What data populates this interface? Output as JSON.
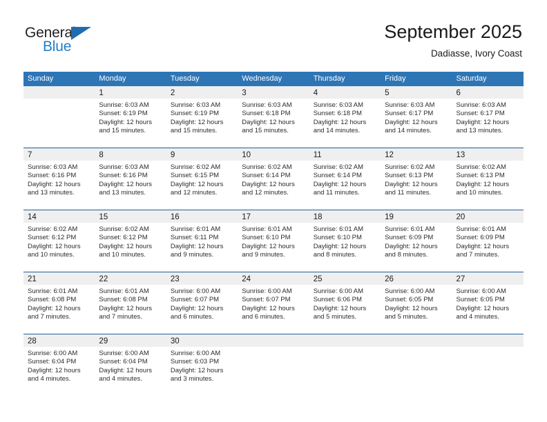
{
  "brand": {
    "name_part1": "General",
    "name_part2": "Blue",
    "triangle_color": "#1f6cb0",
    "blue_color": "#1f7dc9"
  },
  "header": {
    "title": "September 2025",
    "subtitle": "Dadiasse, Ivory Coast"
  },
  "theme": {
    "header_blue": "#2e75b6",
    "row_divider_blue": "#1f5f9e",
    "daynum_band": "#efefef"
  },
  "calendar": {
    "weekday_headers": [
      "Sunday",
      "Monday",
      "Tuesday",
      "Wednesday",
      "Thursday",
      "Friday",
      "Saturday"
    ],
    "weeks": [
      [
        {
          "day": "",
          "sunrise": "",
          "sunset": "",
          "daylight1": "",
          "daylight2": "",
          "empty": true
        },
        {
          "day": "1",
          "sunrise": "Sunrise: 6:03 AM",
          "sunset": "Sunset: 6:19 PM",
          "daylight1": "Daylight: 12 hours",
          "daylight2": "and 15 minutes."
        },
        {
          "day": "2",
          "sunrise": "Sunrise: 6:03 AM",
          "sunset": "Sunset: 6:19 PM",
          "daylight1": "Daylight: 12 hours",
          "daylight2": "and 15 minutes."
        },
        {
          "day": "3",
          "sunrise": "Sunrise: 6:03 AM",
          "sunset": "Sunset: 6:18 PM",
          "daylight1": "Daylight: 12 hours",
          "daylight2": "and 15 minutes."
        },
        {
          "day": "4",
          "sunrise": "Sunrise: 6:03 AM",
          "sunset": "Sunset: 6:18 PM",
          "daylight1": "Daylight: 12 hours",
          "daylight2": "and 14 minutes."
        },
        {
          "day": "5",
          "sunrise": "Sunrise: 6:03 AM",
          "sunset": "Sunset: 6:17 PM",
          "daylight1": "Daylight: 12 hours",
          "daylight2": "and 14 minutes."
        },
        {
          "day": "6",
          "sunrise": "Sunrise: 6:03 AM",
          "sunset": "Sunset: 6:17 PM",
          "daylight1": "Daylight: 12 hours",
          "daylight2": "and 13 minutes."
        }
      ],
      [
        {
          "day": "7",
          "sunrise": "Sunrise: 6:03 AM",
          "sunset": "Sunset: 6:16 PM",
          "daylight1": "Daylight: 12 hours",
          "daylight2": "and 13 minutes."
        },
        {
          "day": "8",
          "sunrise": "Sunrise: 6:03 AM",
          "sunset": "Sunset: 6:16 PM",
          "daylight1": "Daylight: 12 hours",
          "daylight2": "and 13 minutes."
        },
        {
          "day": "9",
          "sunrise": "Sunrise: 6:02 AM",
          "sunset": "Sunset: 6:15 PM",
          "daylight1": "Daylight: 12 hours",
          "daylight2": "and 12 minutes."
        },
        {
          "day": "10",
          "sunrise": "Sunrise: 6:02 AM",
          "sunset": "Sunset: 6:14 PM",
          "daylight1": "Daylight: 12 hours",
          "daylight2": "and 12 minutes."
        },
        {
          "day": "11",
          "sunrise": "Sunrise: 6:02 AM",
          "sunset": "Sunset: 6:14 PM",
          "daylight1": "Daylight: 12 hours",
          "daylight2": "and 11 minutes."
        },
        {
          "day": "12",
          "sunrise": "Sunrise: 6:02 AM",
          "sunset": "Sunset: 6:13 PM",
          "daylight1": "Daylight: 12 hours",
          "daylight2": "and 11 minutes."
        },
        {
          "day": "13",
          "sunrise": "Sunrise: 6:02 AM",
          "sunset": "Sunset: 6:13 PM",
          "daylight1": "Daylight: 12 hours",
          "daylight2": "and 10 minutes."
        }
      ],
      [
        {
          "day": "14",
          "sunrise": "Sunrise: 6:02 AM",
          "sunset": "Sunset: 6:12 PM",
          "daylight1": "Daylight: 12 hours",
          "daylight2": "and 10 minutes."
        },
        {
          "day": "15",
          "sunrise": "Sunrise: 6:02 AM",
          "sunset": "Sunset: 6:12 PM",
          "daylight1": "Daylight: 12 hours",
          "daylight2": "and 10 minutes."
        },
        {
          "day": "16",
          "sunrise": "Sunrise: 6:01 AM",
          "sunset": "Sunset: 6:11 PM",
          "daylight1": "Daylight: 12 hours",
          "daylight2": "and 9 minutes."
        },
        {
          "day": "17",
          "sunrise": "Sunrise: 6:01 AM",
          "sunset": "Sunset: 6:10 PM",
          "daylight1": "Daylight: 12 hours",
          "daylight2": "and 9 minutes."
        },
        {
          "day": "18",
          "sunrise": "Sunrise: 6:01 AM",
          "sunset": "Sunset: 6:10 PM",
          "daylight1": "Daylight: 12 hours",
          "daylight2": "and 8 minutes."
        },
        {
          "day": "19",
          "sunrise": "Sunrise: 6:01 AM",
          "sunset": "Sunset: 6:09 PM",
          "daylight1": "Daylight: 12 hours",
          "daylight2": "and 8 minutes."
        },
        {
          "day": "20",
          "sunrise": "Sunrise: 6:01 AM",
          "sunset": "Sunset: 6:09 PM",
          "daylight1": "Daylight: 12 hours",
          "daylight2": "and 7 minutes."
        }
      ],
      [
        {
          "day": "21",
          "sunrise": "Sunrise: 6:01 AM",
          "sunset": "Sunset: 6:08 PM",
          "daylight1": "Daylight: 12 hours",
          "daylight2": "and 7 minutes."
        },
        {
          "day": "22",
          "sunrise": "Sunrise: 6:01 AM",
          "sunset": "Sunset: 6:08 PM",
          "daylight1": "Daylight: 12 hours",
          "daylight2": "and 7 minutes."
        },
        {
          "day": "23",
          "sunrise": "Sunrise: 6:00 AM",
          "sunset": "Sunset: 6:07 PM",
          "daylight1": "Daylight: 12 hours",
          "daylight2": "and 6 minutes."
        },
        {
          "day": "24",
          "sunrise": "Sunrise: 6:00 AM",
          "sunset": "Sunset: 6:07 PM",
          "daylight1": "Daylight: 12 hours",
          "daylight2": "and 6 minutes."
        },
        {
          "day": "25",
          "sunrise": "Sunrise: 6:00 AM",
          "sunset": "Sunset: 6:06 PM",
          "daylight1": "Daylight: 12 hours",
          "daylight2": "and 5 minutes."
        },
        {
          "day": "26",
          "sunrise": "Sunrise: 6:00 AM",
          "sunset": "Sunset: 6:05 PM",
          "daylight1": "Daylight: 12 hours",
          "daylight2": "and 5 minutes."
        },
        {
          "day": "27",
          "sunrise": "Sunrise: 6:00 AM",
          "sunset": "Sunset: 6:05 PM",
          "daylight1": "Daylight: 12 hours",
          "daylight2": "and 4 minutes."
        }
      ],
      [
        {
          "day": "28",
          "sunrise": "Sunrise: 6:00 AM",
          "sunset": "Sunset: 6:04 PM",
          "daylight1": "Daylight: 12 hours",
          "daylight2": "and 4 minutes."
        },
        {
          "day": "29",
          "sunrise": "Sunrise: 6:00 AM",
          "sunset": "Sunset: 6:04 PM",
          "daylight1": "Daylight: 12 hours",
          "daylight2": "and 4 minutes."
        },
        {
          "day": "30",
          "sunrise": "Sunrise: 6:00 AM",
          "sunset": "Sunset: 6:03 PM",
          "daylight1": "Daylight: 12 hours",
          "daylight2": "and 3 minutes."
        },
        {
          "day": "",
          "sunrise": "",
          "sunset": "",
          "daylight1": "",
          "daylight2": "",
          "empty": true
        },
        {
          "day": "",
          "sunrise": "",
          "sunset": "",
          "daylight1": "",
          "daylight2": "",
          "empty": true
        },
        {
          "day": "",
          "sunrise": "",
          "sunset": "",
          "daylight1": "",
          "daylight2": "",
          "empty": true
        },
        {
          "day": "",
          "sunrise": "",
          "sunset": "",
          "daylight1": "",
          "daylight2": "",
          "empty": true
        }
      ]
    ]
  }
}
